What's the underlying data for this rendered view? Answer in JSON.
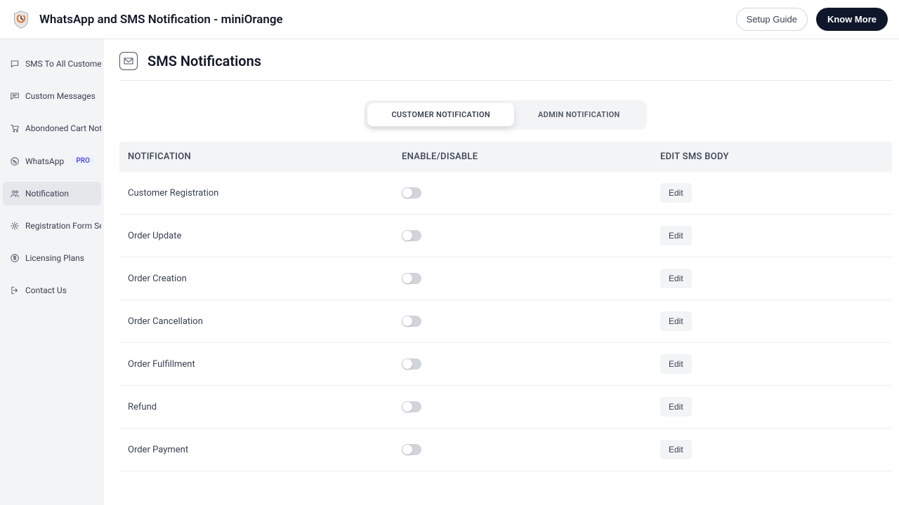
{
  "header": {
    "title": "WhatsApp and SMS Notification - miniOrange",
    "setup_guide": "Setup Guide",
    "know_more": "Know More"
  },
  "sidebar": {
    "items": [
      {
        "label": "SMS To All Customers"
      },
      {
        "label": "Custom Messages"
      },
      {
        "label": "Abondoned Cart Noti..."
      },
      {
        "label": "WhatsApp",
        "badge": "PRO"
      },
      {
        "label": "Notification",
        "active": true
      },
      {
        "label": "Registration Form Set..."
      },
      {
        "label": "Licensing Plans"
      },
      {
        "label": "Contact Us"
      }
    ]
  },
  "page": {
    "title": "SMS Notifications"
  },
  "tabs": {
    "customer": "CUSTOMER NOTIFICATION",
    "admin": "ADMIN NOTIFICATION"
  },
  "table": {
    "headers": {
      "notification": "NOTIFICATION",
      "enable": "ENABLE/DISABLE",
      "edit": "EDIT SMS BODY"
    },
    "edit_label": "Edit",
    "rows": [
      {
        "name": "Customer Registration"
      },
      {
        "name": "Order Update"
      },
      {
        "name": "Order Creation"
      },
      {
        "name": "Order Cancellation"
      },
      {
        "name": "Order Fulfillment"
      },
      {
        "name": "Refund"
      },
      {
        "name": "Order Payment"
      }
    ]
  }
}
